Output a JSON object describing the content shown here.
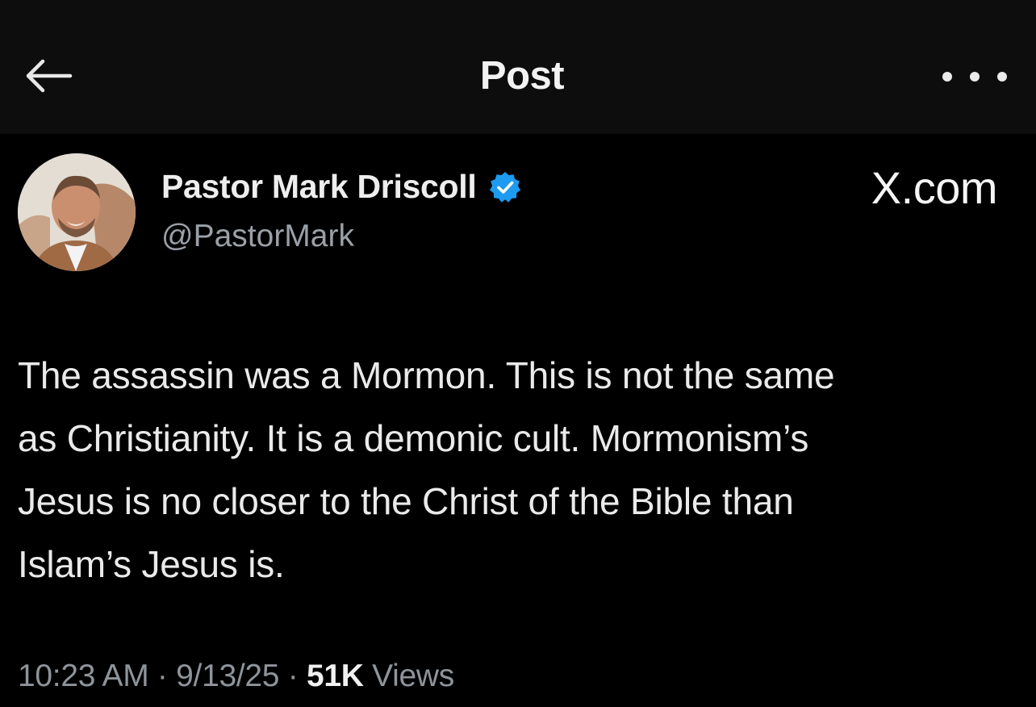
{
  "header": {
    "title": "Post"
  },
  "author": {
    "name": "Pastor Mark Driscoll",
    "handle": "@PastorMark",
    "verified": true,
    "verified_color": "#1d9bf0"
  },
  "watermark": "X.com",
  "post": {
    "lines": [
      "The assassin was a Mormon. This is not the same",
      "as Christianity. It is a demonic cult. Mormonism’s",
      "Jesus is no closer to the Christ of the Bible than",
      "Islam’s Jesus is."
    ]
  },
  "meta": {
    "time": "10:23 AM",
    "sep1": " · ",
    "date": "9/13/25",
    "sep2": " · ",
    "views_count": "51K",
    "views_label": " Views"
  },
  "icons": {
    "back": "arrow-left-icon",
    "more": "more-horizontal-icon",
    "verified": "verified-badge-icon"
  },
  "colors": {
    "background": "#000000",
    "header_background": "#0d0d0d",
    "text_primary": "#eaeaea",
    "text_secondary": "#8e949a"
  }
}
